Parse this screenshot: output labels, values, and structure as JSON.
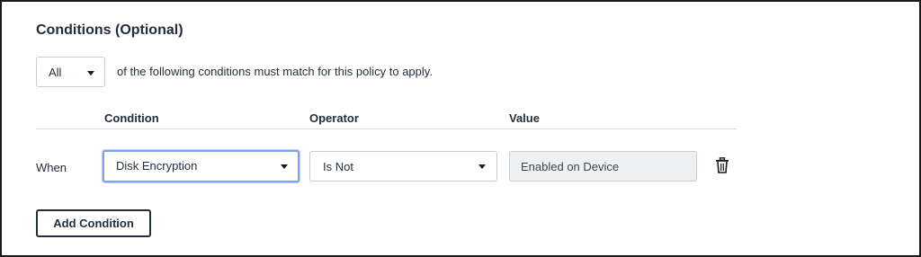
{
  "section": {
    "title": "Conditions (Optional)"
  },
  "match": {
    "selected": "All",
    "description": "of the following conditions must match for this policy to apply."
  },
  "table": {
    "headers": {
      "condition": "Condition",
      "operator": "Operator",
      "value": "Value"
    },
    "rows": [
      {
        "prefix": "When",
        "condition": "Disk Encryption",
        "operator": "Is Not",
        "value": "Enabled on Device"
      }
    ]
  },
  "actions": {
    "add_condition": "Add Condition"
  },
  "icons": {
    "dropdown": "chevron-down-icon",
    "delete": "trash-icon"
  },
  "colors": {
    "focus_ring": "#7ea2f0",
    "text": "#1f2d3d",
    "disabled_field": "#eef0f2"
  }
}
